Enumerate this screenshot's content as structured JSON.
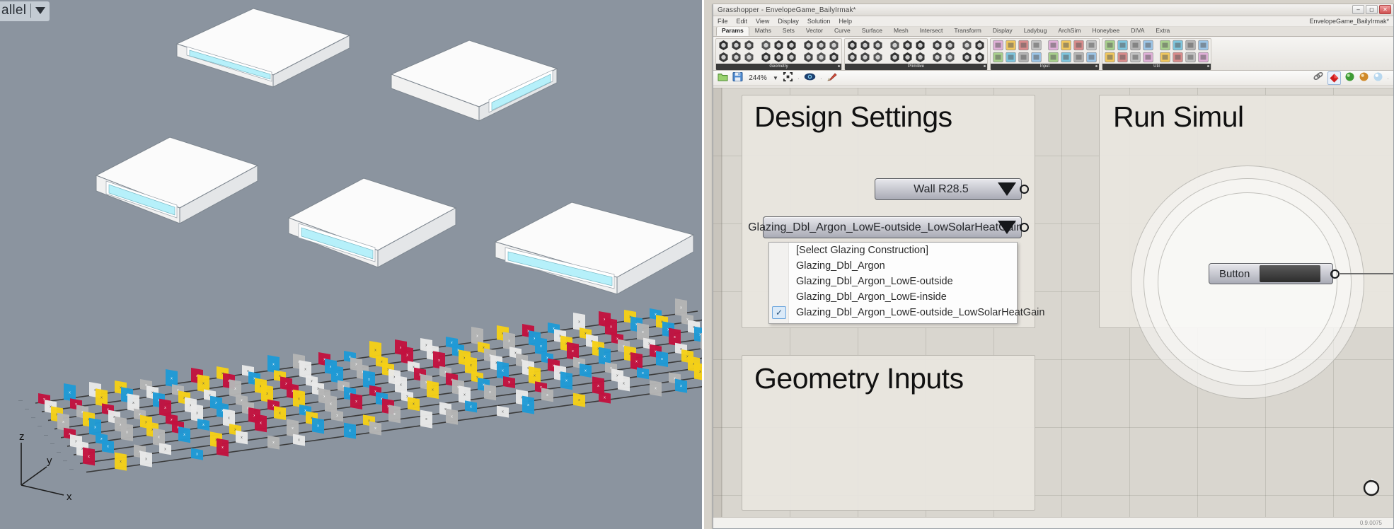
{
  "rhino": {
    "viewport_label": "allel",
    "viewport_dropdown_icon": "chevron-down-icon",
    "axis": {
      "x": "x",
      "y": "y",
      "z": "z"
    }
  },
  "grasshopper": {
    "window_title": "Grasshopper - EnvelopeGame_BailyIrmak*",
    "document_name": "EnvelopeGame_BailyIrmak*",
    "window_buttons": [
      "minimize",
      "maximize",
      "close"
    ],
    "menu": [
      "File",
      "Edit",
      "View",
      "Display",
      "Solution",
      "Help"
    ],
    "tabs": [
      "Params",
      "Maths",
      "Sets",
      "Vector",
      "Curve",
      "Surface",
      "Mesh",
      "Intersect",
      "Transform",
      "Display",
      "Ladybug",
      "ArchSim",
      "Honeybee",
      "DIVA",
      "Extra"
    ],
    "active_tab": "Params",
    "ribbon_groups": [
      "Geometry",
      "Primitive",
      "Input",
      "Util"
    ],
    "statusbar": {
      "lock_icon": "unlock-folder-icon",
      "save_icon": "save-icon",
      "zoom_level": "244%",
      "zoom_dropdown_icon": "chevron-down-icon",
      "zoom_extents_icon": "zoom-extents-icon",
      "preview_icon": "eye-icon",
      "draw_icon": "paintbrush-icon",
      "right_icons": [
        "link-icon",
        "red-sphere-icon",
        "green-sphere-icon",
        "amber-sphere-icon",
        "blue-sphere-icon"
      ]
    },
    "canvas": {
      "groups": [
        {
          "title": "Design Settings"
        },
        {
          "title": "Run Simul"
        },
        {
          "title": "Geometry Inputs"
        }
      ],
      "components": {
        "wall_value_list": {
          "label": "Wall R28.5",
          "dropdown_icon": "triangle-down-icon"
        },
        "glazing_value_list": {
          "label": "Glazing_Dbl_Argon_LowE-outside_LowSolarHeatGain",
          "dropdown_icon": "triangle-down-icon"
        },
        "run_button": {
          "label": "Button"
        }
      },
      "dropdown": {
        "items": [
          {
            "label": "[Select Glazing Construction]",
            "checked": false
          },
          {
            "label": "Glazing_Dbl_Argon",
            "checked": false
          },
          {
            "label": "Glazing_Dbl_Argon_LowE-outside",
            "checked": false
          },
          {
            "label": "Glazing_Dbl_Argon_LowE-inside",
            "checked": false
          },
          {
            "label": "Glazing_Dbl_Argon_LowE-outside_LowSolarHeatGain",
            "checked": true
          }
        ],
        "check_glyph": "✓"
      }
    },
    "bottombar": {
      "version": "0.9.0075",
      "refresh_icon": "refresh-icon"
    }
  },
  "colors": {
    "viewport_bg": "#8b949f",
    "glazing": "#b6f0fa",
    "bar_red": "#c2123f",
    "bar_blue": "#1f9ad6",
    "bar_yellow": "#f5cf17",
    "bar_white": "#e8e8e8",
    "bar_gray": "#b5b5b5",
    "gh_canvas": "#d9d6cf",
    "gh_group": "#e9e6df",
    "component_border": "#5d5f63"
  }
}
